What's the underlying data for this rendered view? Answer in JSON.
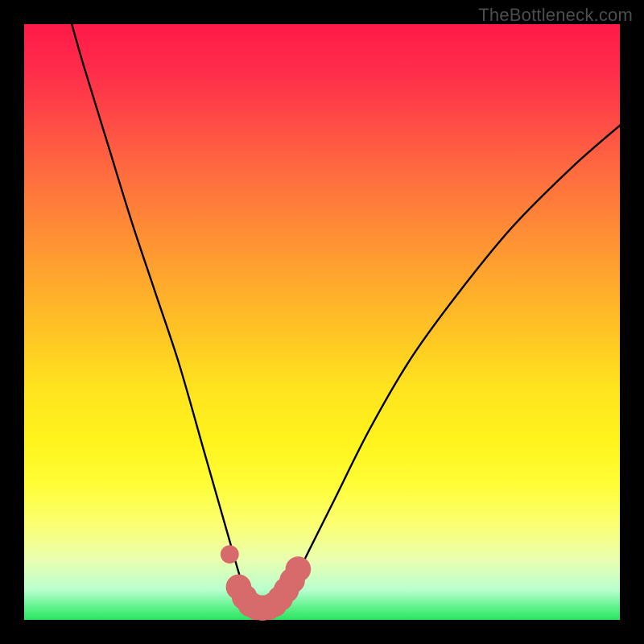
{
  "watermark": "TheBottleneck.com",
  "chart_data": {
    "type": "line",
    "title": "",
    "xlabel": "",
    "ylabel": "",
    "xlim": [
      0,
      100
    ],
    "ylim": [
      0,
      100
    ],
    "series": [
      {
        "name": "bottleneck-curve",
        "x": [
          8,
          10,
          14,
          18,
          22,
          26,
          30,
          32,
          34,
          36,
          37,
          38,
          39,
          40,
          41,
          42,
          43,
          45,
          48,
          52,
          58,
          65,
          73,
          82,
          92,
          100
        ],
        "values": [
          100,
          93,
          80,
          67,
          55,
          43,
          29,
          22,
          15,
          8,
          5,
          3,
          2,
          2,
          2,
          2,
          3,
          6,
          12,
          20,
          32,
          44,
          55,
          66,
          76,
          83
        ]
      }
    ],
    "markers": {
      "name": "highlight-dots",
      "color": "#d76a6a",
      "points": [
        {
          "x": 34.5,
          "y": 11,
          "r": 1.0
        },
        {
          "x": 36.0,
          "y": 5.5,
          "r": 1.6
        },
        {
          "x": 37.0,
          "y": 3.8,
          "r": 1.6
        },
        {
          "x": 38.0,
          "y": 2.6,
          "r": 1.6
        },
        {
          "x": 39.0,
          "y": 2.1,
          "r": 1.6
        },
        {
          "x": 40.0,
          "y": 2.0,
          "r": 1.6
        },
        {
          "x": 41.0,
          "y": 2.1,
          "r": 1.6
        },
        {
          "x": 42.0,
          "y": 2.6,
          "r": 1.6
        },
        {
          "x": 43.0,
          "y": 3.6,
          "r": 1.6
        },
        {
          "x": 44.0,
          "y": 5.0,
          "r": 1.6
        },
        {
          "x": 45.0,
          "y": 6.6,
          "r": 1.6
        },
        {
          "x": 46.0,
          "y": 8.5,
          "r": 1.6
        }
      ]
    }
  }
}
